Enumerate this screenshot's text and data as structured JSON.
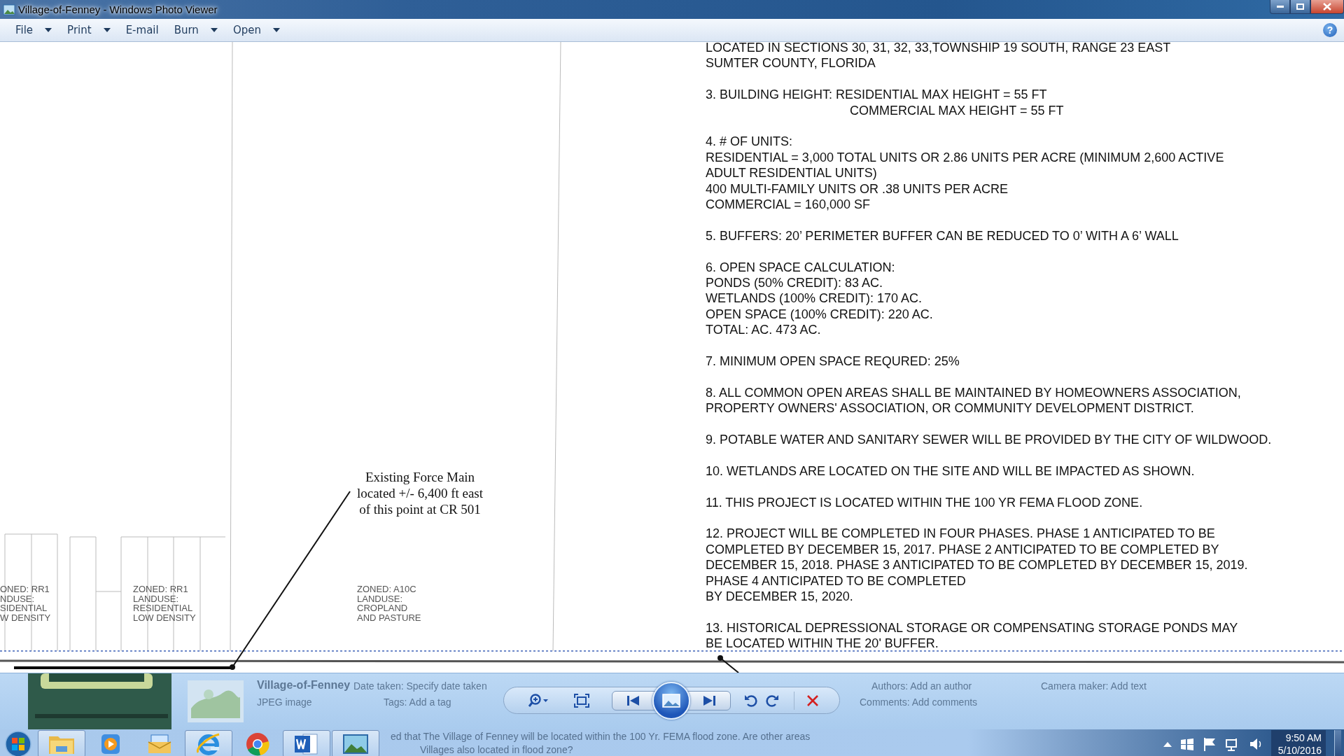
{
  "window": {
    "title": "Village-of-Fenney - Windows Photo Viewer"
  },
  "menu": [
    {
      "label": "File",
      "dropdown": true
    },
    {
      "label": "Print",
      "dropdown": true
    },
    {
      "label": "E-mail",
      "dropdown": false
    },
    {
      "label": "Burn",
      "dropdown": true
    },
    {
      "label": "Open",
      "dropdown": true
    }
  ],
  "help": {
    "label": "?"
  },
  "document": {
    "notes": [
      {
        "lines": [
          "LOCATED IN SECTIONS 30, 31, 32, 33,TOWNSHIP 19 SOUTH, RANGE 23 EAST",
          "SUMTER COUNTY, FLORIDA"
        ],
        "indent_rest": false
      },
      {
        "lines": [
          "3. BUILDING HEIGHT: RESIDENTIAL MAX HEIGHT = 55 FT",
          "COMMERCIAL MAX HEIGHT = 55 FT"
        ],
        "indent_rest": true
      },
      {
        "lines": [
          "4. # OF UNITS:",
          "RESIDENTIAL = 3,000 TOTAL UNITS OR 2.86 UNITS PER ACRE  (MINIMUM 2,600 ACTIVE",
          "ADULT RESIDENTIAL UNITS)",
          "400 MULTI-FAMILY UNITS OR .38 UNITS PER ACRE",
          "COMMERCIAL = 160,000 SF"
        ],
        "indent_rest": false
      },
      {
        "lines": [
          "5. BUFFERS:  20’ PERIMETER BUFFER CAN BE REDUCED TO 0’ WITH A 6’ WALL"
        ],
        "indent_rest": false
      },
      {
        "lines": [
          "6.  OPEN SPACE CALCULATION:",
          "PONDS (50% CREDIT):  83 AC.",
          "WETLANDS (100% CREDIT): 170 AC.",
          "OPEN SPACE (100% CREDIT): 220 AC.",
          "TOTAL:  AC.  473 AC."
        ],
        "indent_rest": false
      },
      {
        "lines": [
          "7. MINIMUM OPEN SPACE REQURED:  25%"
        ],
        "indent_rest": false
      },
      {
        "lines": [
          "8. ALL COMMON OPEN AREAS SHALL BE MAINTAINED BY HOMEOWNERS ASSOCIATION,",
          "PROPERTY OWNERS' ASSOCIATION, OR COMMUNITY DEVELOPMENT DISTRICT."
        ],
        "indent_rest": false
      },
      {
        "lines": [
          "9. POTABLE WATER AND SANITARY SEWER WILL BE PROVIDED BY THE CITY OF WILDWOOD."
        ],
        "indent_rest": false
      },
      {
        "lines": [
          "10. WETLANDS ARE LOCATED ON THE SITE AND WILL BE IMPACTED AS SHOWN."
        ],
        "indent_rest": false
      },
      {
        "lines": [
          "11. THIS PROJECT IS LOCATED WITHIN THE 100 YR FEMA FLOOD ZONE."
        ],
        "indent_rest": false
      },
      {
        "lines": [
          "12. PROJECT WILL BE COMPLETED IN FOUR PHASES.  PHASE 1 ANTICIPATED TO BE",
          "COMPLETED BY DECEMBER 15, 2017.  PHASE 2 ANTICIPATED TO BE COMPLETED BY",
          "DECEMBER 15, 2018.  PHASE 3 ANTICIPATED TO BE COMPLETED BY DECEMBER 15, 2019.",
          "PHASE 4 ANTICIPATED TO BE COMPLETED",
          "BY DECEMBER 15, 2020."
        ],
        "indent_rest": false
      },
      {
        "lines": [
          "13.  HISTORICAL DEPRESSIONAL STORAGE OR COMPENSATING STORAGE PONDS MAY",
          "BE LOCATED WITHIN THE 20' BUFFER."
        ],
        "indent_rest": false
      }
    ],
    "callout": {
      "lines": [
        "Existing Force Main",
        "located +/- 6,400 ft east",
        "of this point at CR 501"
      ]
    },
    "zone_labels": [
      {
        "lines": [
          "ONED: RR1",
          "NDUSE:",
          "SIDENTIAL",
          "W DENSITY"
        ]
      },
      {
        "lines": [
          "ZONED: RR1",
          "LANDUSE:",
          "RESIDENTIAL",
          "LOW DENSITY"
        ]
      },
      {
        "lines": [
          "ZONED: A10C",
          "LANDUSE:",
          "CROPLAND",
          "AND PASTURE"
        ]
      }
    ]
  },
  "details": {
    "name": "Village-of-Fenney",
    "type": "JPEG image",
    "fields": [
      {
        "label": "Date taken:",
        "value": "Specify date taken"
      },
      {
        "label": "Tags:",
        "value": "Add a tag"
      },
      {
        "label": "Authors:",
        "value": "Add an author"
      },
      {
        "label": "Comments:",
        "value": "Add comments"
      },
      {
        "label": "Camera maker:",
        "value": "Add text"
      }
    ]
  },
  "controls": [
    {
      "kind": "zoom"
    },
    {
      "kind": "fit"
    },
    {
      "kind": "previous"
    },
    {
      "kind": "slideshow"
    },
    {
      "kind": "next"
    },
    {
      "kind": "rotate_left"
    },
    {
      "kind": "rotate_right"
    },
    {
      "kind": "delete"
    }
  ],
  "taskbar": {
    "apps": [
      {
        "kind": "explorer",
        "running": true
      },
      {
        "kind": "media",
        "running": false
      },
      {
        "kind": "mail",
        "running": false
      },
      {
        "kind": "ie",
        "running": true
      },
      {
        "kind": "chrome",
        "running": false
      },
      {
        "kind": "word",
        "running": true
      },
      {
        "kind": "photos",
        "running": true
      }
    ],
    "background_text": [
      "ed that The Village of Fenney will be located within the 100 Yr. FEMA flood zone. Are other areas",
      "Villages also located in flood zone?"
    ],
    "clock": {
      "time": "9:50 AM",
      "date": "5/10/2016"
    }
  }
}
